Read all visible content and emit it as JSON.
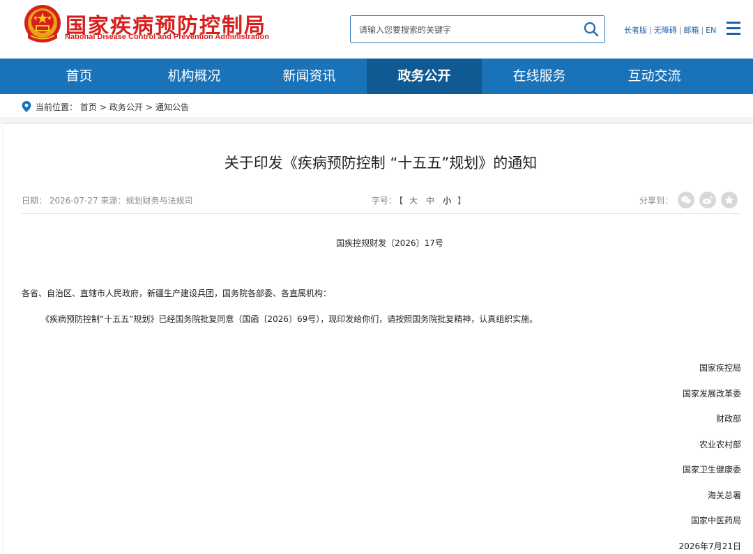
{
  "header": {
    "title": "国家疾病预防控制局",
    "subtitle": "National Disease Control and Prevention Administration",
    "search_placeholder": "请输入您要搜索的关键字",
    "links": [
      "长者版",
      "无障碍",
      "邮箱",
      "EN"
    ],
    "emblem_icon": "national-emblem-icon",
    "brand_color": "#d7201e"
  },
  "nav": {
    "items": [
      {
        "label": "首页"
      },
      {
        "label": "机构概况"
      },
      {
        "label": "新闻资讯"
      },
      {
        "label": "政务公开",
        "active": true
      },
      {
        "label": "在线服务"
      },
      {
        "label": "互动交流"
      }
    ],
    "bg_color": "#1a73b8",
    "active_color": "#105a93"
  },
  "breadcrumb": {
    "prefix": "当前位置：",
    "items": [
      "首页",
      "政务公开",
      "通知公告"
    ],
    "separator": ">"
  },
  "article": {
    "title": "关于印发《疾病预防控制 “十五五”规划》的通知",
    "date_label": "日期：",
    "date": "2026-07-27",
    "source_label": "来源：",
    "source": "规划财务与法规司",
    "fontsize_label": "字号：",
    "fontsize_open": "【",
    "fontsize_options": [
      "大",
      "中",
      "小"
    ],
    "fontsize_close": "】",
    "share_label": "分享到：",
    "share_icons": [
      "wechat-icon",
      "weibo-icon",
      "favorite-icon"
    ],
    "doc_number": "国疾控规财发〔2026〕17号",
    "addressee": "各省、自治区、直辖市人民政府，新疆生产建设兵团，国务院各部委、各直属机构：",
    "body": "《疾病预防控制“十五五”规划》已经国务院批复同意（国函〔2026〕69号），现印发给你们，请按照国务院批复精神，认真组织实施。",
    "signers": [
      "国家疾控局",
      "国家发展改革委",
      "财政部",
      "农业农村部",
      "国家卫生健康委",
      "海关总署",
      "国家中医药局"
    ],
    "sign_date": "2026年7月21日"
  }
}
